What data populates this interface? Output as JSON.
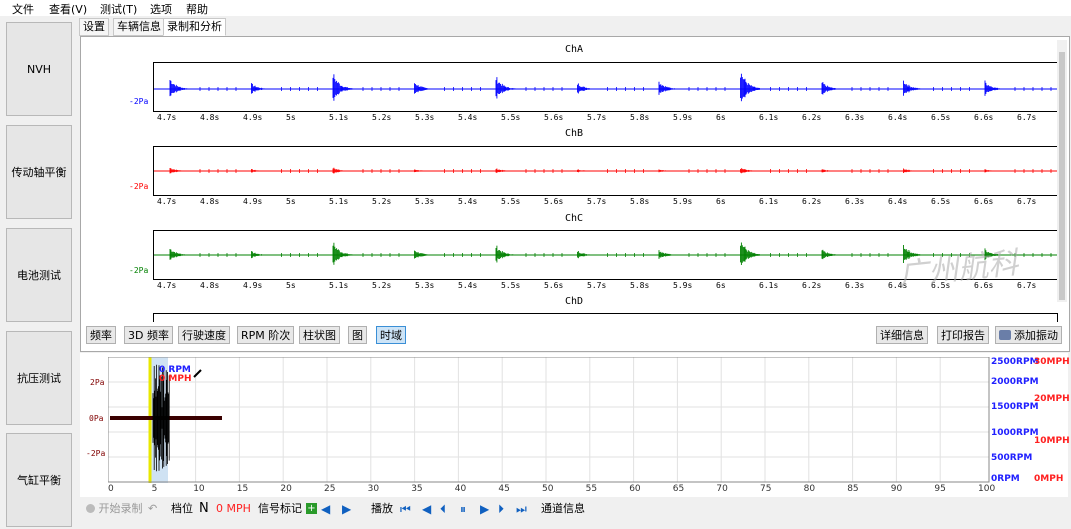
{
  "menu": [
    "文件",
    "查看(V)",
    "测试(T)",
    "选项",
    "帮助"
  ],
  "sidebar": [
    "NVH",
    "传动轴平衡",
    "电池测试",
    "抗压测试",
    "气缸平衡"
  ],
  "tabs": [
    "设置",
    "车辆信息",
    "录制和分析"
  ],
  "channels": [
    {
      "name": "ChA",
      "color": "#0000ff",
      "ylabel": "-2Pa"
    },
    {
      "name": "ChB",
      "color": "#ff0000",
      "ylabel": "-2Pa"
    },
    {
      "name": "ChC",
      "color": "#008000",
      "ylabel": "-2Pa"
    },
    {
      "name": "ChD"
    }
  ],
  "time_ticks": [
    "4.7s",
    "4.8s",
    "4.9s",
    "5s",
    "5.1s",
    "5.2s",
    "5.3s",
    "5.4s",
    "5.5s",
    "5.6s",
    "5.7s",
    "5.8s",
    "5.9s",
    "6s",
    "6.1s",
    "6.2s",
    "6.3s",
    "6.4s",
    "6.5s",
    "6.6s",
    "6.7s"
  ],
  "toolbar_left": [
    "频率",
    "3D 频率",
    "行驶速度",
    "RPM 阶次",
    "柱状图",
    "图",
    "时域"
  ],
  "toolbar_right": [
    "详细信息",
    "打印报告",
    "添加振动"
  ],
  "overview": {
    "y_labels": [
      "2Pa",
      "0Pa",
      "-2Pa"
    ],
    "rpm_labels": [
      "2500RPM",
      "2000RPM",
      "1500RPM",
      "1000RPM",
      "500RPM",
      "0RPM"
    ],
    "mph_labels": [
      "30MPH",
      "20MPH",
      "10MPH",
      "0MPH"
    ],
    "x_labels": [
      "0",
      "5",
      "10",
      "15",
      "20",
      "25",
      "30",
      "35",
      "40",
      "45",
      "50",
      "55",
      "60",
      "65",
      "70",
      "75",
      "80",
      "85",
      "90",
      "95",
      "100"
    ],
    "cursor_rpm": "0 RPM",
    "cursor_mph": "0 MPH"
  },
  "bottom": {
    "record": "开始录制",
    "gear_label": "档位",
    "gear_value": "N",
    "speed": "0 MPH",
    "signal_mark": "信号标记",
    "playback": "播放",
    "channel_info": "通道信息"
  },
  "watermark": "广州航科"
}
